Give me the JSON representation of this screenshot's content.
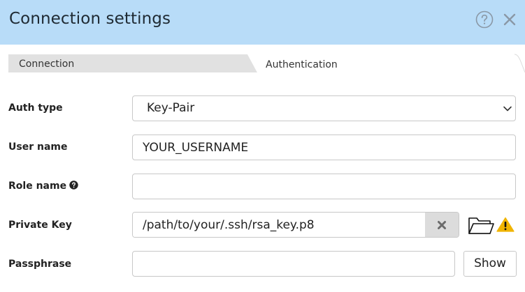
{
  "dialog": {
    "title": "Connection settings",
    "help_icon": "question-circle-icon",
    "close_icon": "close-icon"
  },
  "tabs": [
    {
      "label": "Connection",
      "active": false
    },
    {
      "label": "Authentication",
      "active": true
    }
  ],
  "form": {
    "auth_type": {
      "label": "Auth type",
      "value": "Key-Pair"
    },
    "user_name": {
      "label": "User name",
      "value": "YOUR_USERNAME"
    },
    "role_name": {
      "label": "Role name",
      "value": "",
      "help_icon": "question-circle-icon"
    },
    "private_key": {
      "label": "Private Key",
      "value": "/path/to/your/.ssh/rsa_key.p8",
      "clear_icon": "clear-x-icon",
      "folder_icon": "folder-icon",
      "warning_icon": "warning-icon"
    },
    "passphrase": {
      "label": "Passphrase",
      "value": "",
      "show_label": "Show"
    }
  },
  "colors": {
    "header_bg": "#b8dcf8",
    "tab_inactive": "#e1e1e1",
    "warning": "#f0b400"
  }
}
